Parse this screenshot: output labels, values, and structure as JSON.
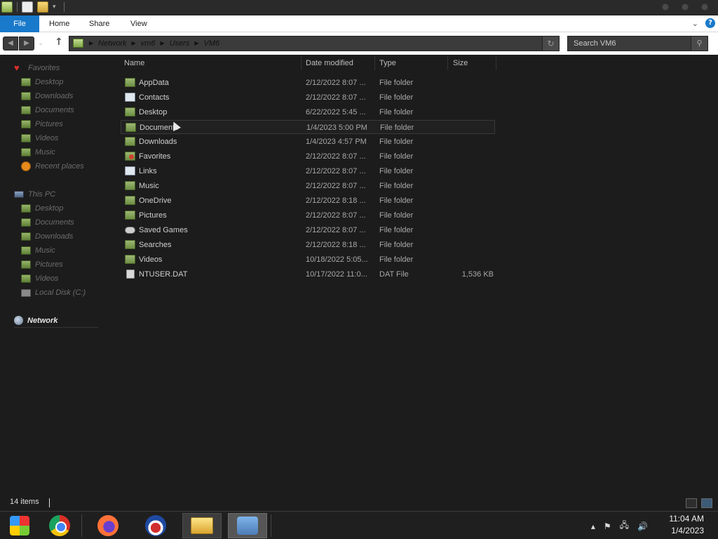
{
  "ribbon": {
    "tabs": [
      "File",
      "Home",
      "Share",
      "View"
    ]
  },
  "address": {
    "crumbs": [
      "Network",
      "vm6",
      "Users",
      "VM6"
    ]
  },
  "search": {
    "placeholder": "Search VM6"
  },
  "sidebar": {
    "favorites_header": "Favorites",
    "favorites": [
      "Desktop",
      "Downloads",
      "Documents",
      "Pictures",
      "Videos",
      "Music",
      "Recent places"
    ],
    "thispc_header": "This PC",
    "thispc": [
      "Desktop",
      "Documents",
      "Downloads",
      "Music",
      "Pictures",
      "Videos",
      "Local Disk (C:)"
    ],
    "network": "Network"
  },
  "columns": {
    "name": "Name",
    "date": "Date modified",
    "type": "Type",
    "size": "Size"
  },
  "files": [
    {
      "name": "AppData",
      "date": "2/12/2022 8:07 ...",
      "type": "File folder",
      "size": ""
    },
    {
      "name": "Contacts",
      "date": "2/12/2022 8:07 ...",
      "type": "File folder",
      "size": ""
    },
    {
      "name": "Desktop",
      "date": "6/22/2022 5:45 ...",
      "type": "File folder",
      "size": ""
    },
    {
      "name": "Documents",
      "date": "1/4/2023 5:00 PM",
      "type": "File folder",
      "size": ""
    },
    {
      "name": "Downloads",
      "date": "1/4/2023 4:57 PM",
      "type": "File folder",
      "size": ""
    },
    {
      "name": "Favorites",
      "date": "2/12/2022 8:07 ...",
      "type": "File folder",
      "size": ""
    },
    {
      "name": "Links",
      "date": "2/12/2022 8:07 ...",
      "type": "File folder",
      "size": ""
    },
    {
      "name": "Music",
      "date": "2/12/2022 8:07 ...",
      "type": "File folder",
      "size": ""
    },
    {
      "name": "OneDrive",
      "date": "2/12/2022 8:18 ...",
      "type": "File folder",
      "size": ""
    },
    {
      "name": "Pictures",
      "date": "2/12/2022 8:07 ...",
      "type": "File folder",
      "size": ""
    },
    {
      "name": "Saved Games",
      "date": "2/12/2022 8:07 ...",
      "type": "File folder",
      "size": ""
    },
    {
      "name": "Searches",
      "date": "2/12/2022 8:18 ...",
      "type": "File folder",
      "size": ""
    },
    {
      "name": "Videos",
      "date": "10/18/2022 5:05...",
      "type": "File folder",
      "size": ""
    },
    {
      "name": "NTUSER.DAT",
      "date": "10/17/2022 11:0...",
      "type": "DAT File",
      "size": "1,536 KB"
    }
  ],
  "status": {
    "count": "14 items"
  },
  "clock": {
    "time": "11:04 AM",
    "date": "1/4/2023"
  }
}
